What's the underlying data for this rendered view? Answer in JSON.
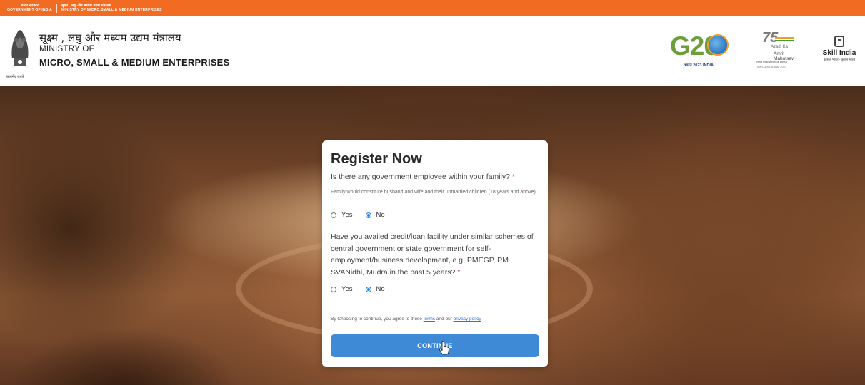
{
  "topbar": {
    "gov_hindi": "भारत सरकार",
    "gov_english": "GOVERNMENT OF INDIA",
    "ministry_hindi": "सूक्ष्म , लघु और मध्यम उद्यम मंत्रालय",
    "ministry_english": "MINISTRY OF MICRO,SMALL & MEDIUM ENTERPRISES"
  },
  "header": {
    "emblem_motto": "सत्यमेव जयते",
    "title_hindi": "सूक्ष्म , लघु और मध्यम उद्यम मंत्रालय",
    "ministry_of": "MINISTRY OF",
    "ministry_name": "MICRO, SMALL & MEDIUM ENTERPRISES",
    "logos": {
      "g20": "G20",
      "g20_sub": "भारत 2023 INDIA",
      "azadi_75": "75",
      "azadi_line1": "Azadi Ka",
      "azadi_line2": "Amrit Mahotsav",
      "azadi_line3": "Meri Maati Mera Desh",
      "azadi_line4": "09th–30th August 2023",
      "skill_name": "Skill India",
      "skill_sub": "कौशल भारत - कुशल भारत"
    }
  },
  "form": {
    "title": "Register Now",
    "q1": {
      "text": "Is there any government employee within your family?",
      "required_mark": "*",
      "note": "Family would constitute husband and wife and their unmarried children (18 years and above)",
      "options": [
        "Yes",
        "No"
      ],
      "selected": "No"
    },
    "q2": {
      "text": "Have you availed credit/loan facility under similar schemes of central government or state government for self-employment/business development, e.g. PMEGP, PM SVANidhi, Mudra in the past 5 years?",
      "required_mark": "*",
      "options": [
        "Yes",
        "No"
      ],
      "selected": "No"
    },
    "consent_prefix": "By Choosing to continue, you agree to these",
    "terms_link": "terms",
    "consent_middle": "and our",
    "privacy_link": "privacy policy",
    "continue_label": "CONTINUE"
  },
  "colors": {
    "topbar": "#f26b22",
    "accent": "#3f8ad6",
    "required": "#e53935"
  }
}
